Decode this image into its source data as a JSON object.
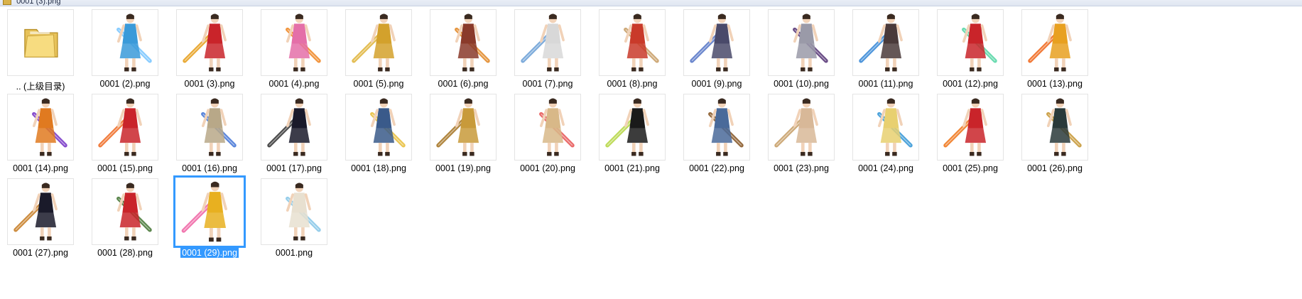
{
  "window": {
    "path_fragment": "0001 (3).png"
  },
  "files": [
    {
      "label": ".. (上级目录)",
      "kind": "folder",
      "icon": "folder-icon"
    },
    {
      "label": "0001 (2).png",
      "kind": "png",
      "accent": "#3a9ad9",
      "weapon": "#7cc7ff"
    },
    {
      "label": "0001 (3).png",
      "kind": "png",
      "accent": "#c9242a",
      "weapon": "#e7a121"
    },
    {
      "label": "0001 (4).png",
      "kind": "png",
      "accent": "#e46fa8",
      "weapon": "#f08a2a"
    },
    {
      "label": "0001 (5).png",
      "kind": "png",
      "accent": "#d3a12c",
      "weapon": "#e0b640"
    },
    {
      "label": "0001 (6).png",
      "kind": "png",
      "accent": "#8a3a2a",
      "weapon": "#e38b2c"
    },
    {
      "label": "0001 (7).png",
      "kind": "png",
      "accent": "#d8d8d8",
      "weapon": "#6fa3d8"
    },
    {
      "label": "0001 (8).png",
      "kind": "png",
      "accent": "#c93a2a",
      "weapon": "#c9a06a"
    },
    {
      "label": "0001 (9).png",
      "kind": "png",
      "accent": "#4a4a6a",
      "weapon": "#5a7ac8"
    },
    {
      "label": "0001 (10).png",
      "kind": "png",
      "accent": "#9a9aa8",
      "weapon": "#5a3a7a"
    },
    {
      "label": "0001 (11).png",
      "kind": "png",
      "accent": "#4a3a3a",
      "weapon": "#3a8ad8"
    },
    {
      "label": "0001 (12).png",
      "kind": "png",
      "accent": "#c9242a",
      "weapon": "#5ad8a8"
    },
    {
      "label": "0001 (13).png",
      "kind": "png",
      "accent": "#e8a020",
      "weapon": "#f06a20"
    },
    {
      "label": "0001 (14).png",
      "kind": "png",
      "accent": "#e07a20",
      "weapon": "#7a3ac8"
    },
    {
      "label": "0001 (15).png",
      "kind": "png",
      "accent": "#c9242a",
      "weapon": "#f0702a"
    },
    {
      "label": "0001 (16).png",
      "kind": "png",
      "accent": "#b8a888",
      "weapon": "#4a7ad8"
    },
    {
      "label": "0001 (17).png",
      "kind": "png",
      "accent": "#1a1a2a",
      "weapon": "#3a3a3a"
    },
    {
      "label": "0001 (18).png",
      "kind": "png",
      "accent": "#3a5a8a",
      "weapon": "#e8c040"
    },
    {
      "label": "0001 (19).png",
      "kind": "png",
      "accent": "#c89a3a",
      "weapon": "#a8782a"
    },
    {
      "label": "0001 (20).png",
      "kind": "png",
      "accent": "#d8b888",
      "weapon": "#e85a5a"
    },
    {
      "label": "0001 (21).png",
      "kind": "png",
      "accent": "#1a1a1a",
      "weapon": "#b8d84a"
    },
    {
      "label": "0001 (22).png",
      "kind": "png",
      "accent": "#4a6a9a",
      "weapon": "#8a5a2a"
    },
    {
      "label": "0001 (23).png",
      "kind": "png",
      "accent": "#d8b898",
      "weapon": "#c8a06a"
    },
    {
      "label": "0001 (24).png",
      "kind": "png",
      "accent": "#e8d070",
      "weapon": "#3a9ad8"
    },
    {
      "label": "0001 (25).png",
      "kind": "png",
      "accent": "#c9242a",
      "weapon": "#f07a20"
    },
    {
      "label": "0001 (26).png",
      "kind": "png",
      "accent": "#2a3a3a",
      "weapon": "#c89a3a"
    },
    {
      "label": "0001 (27).png",
      "kind": "png",
      "accent": "#1a1a2a",
      "weapon": "#c8802a"
    },
    {
      "label": "0001 (28).png",
      "kind": "png",
      "accent": "#c9242a",
      "weapon": "#4a7a3a"
    },
    {
      "label": "0001 (29).png",
      "kind": "png",
      "accent": "#e8b020",
      "weapon": "#f06aa8",
      "selected": true
    },
    {
      "label": "0001.png",
      "kind": "png",
      "accent": "#e8e0d0",
      "weapon": "#8ac8e8"
    }
  ]
}
